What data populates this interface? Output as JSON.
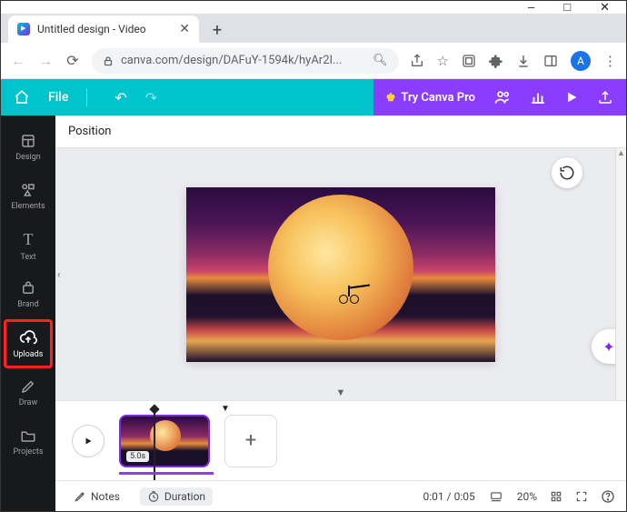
{
  "window": {
    "controls": [
      "minimize",
      "maximize",
      "close"
    ]
  },
  "browser": {
    "tab_title": "Untitled design - Video",
    "url_display": "canva.com/design/DAFuY-1594k/hyAr2I...",
    "avatar_letter": "A"
  },
  "appnav": {
    "file_label": "File",
    "try_pro_label": "Try Canva Pro"
  },
  "rail": {
    "items": [
      {
        "key": "design",
        "label": "Design"
      },
      {
        "key": "elements",
        "label": "Elements"
      },
      {
        "key": "text",
        "label": "Text"
      },
      {
        "key": "brand",
        "label": "Brand"
      },
      {
        "key": "uploads",
        "label": "Uploads"
      },
      {
        "key": "draw",
        "label": "Draw"
      },
      {
        "key": "projects",
        "label": "Projects"
      }
    ]
  },
  "toolbar": {
    "position_label": "Position"
  },
  "timeline": {
    "clip_duration": "5.0s",
    "time_display": "0:01 / 0:05",
    "zoom_level": "20%"
  },
  "bottombar": {
    "notes_label": "Notes",
    "duration_label": "Duration"
  }
}
